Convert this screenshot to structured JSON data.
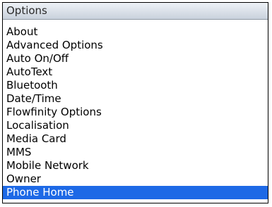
{
  "window": {
    "title": "Options"
  },
  "menu": {
    "items": [
      {
        "label": "About"
      },
      {
        "label": "Advanced Options"
      },
      {
        "label": "Auto On/Off"
      },
      {
        "label": "AutoText"
      },
      {
        "label": "Bluetooth"
      },
      {
        "label": "Date/Time"
      },
      {
        "label": "Flowfinity Options"
      },
      {
        "label": "Localisation"
      },
      {
        "label": "Media Card"
      },
      {
        "label": "MMS"
      },
      {
        "label": "Mobile Network"
      },
      {
        "label": "Owner"
      },
      {
        "label": "Phone Home",
        "selected": true
      }
    ]
  },
  "colors": {
    "selection_bg": "#1d69e6",
    "selection_text": "#ffffff",
    "title_bar": "#dfe4eb"
  }
}
